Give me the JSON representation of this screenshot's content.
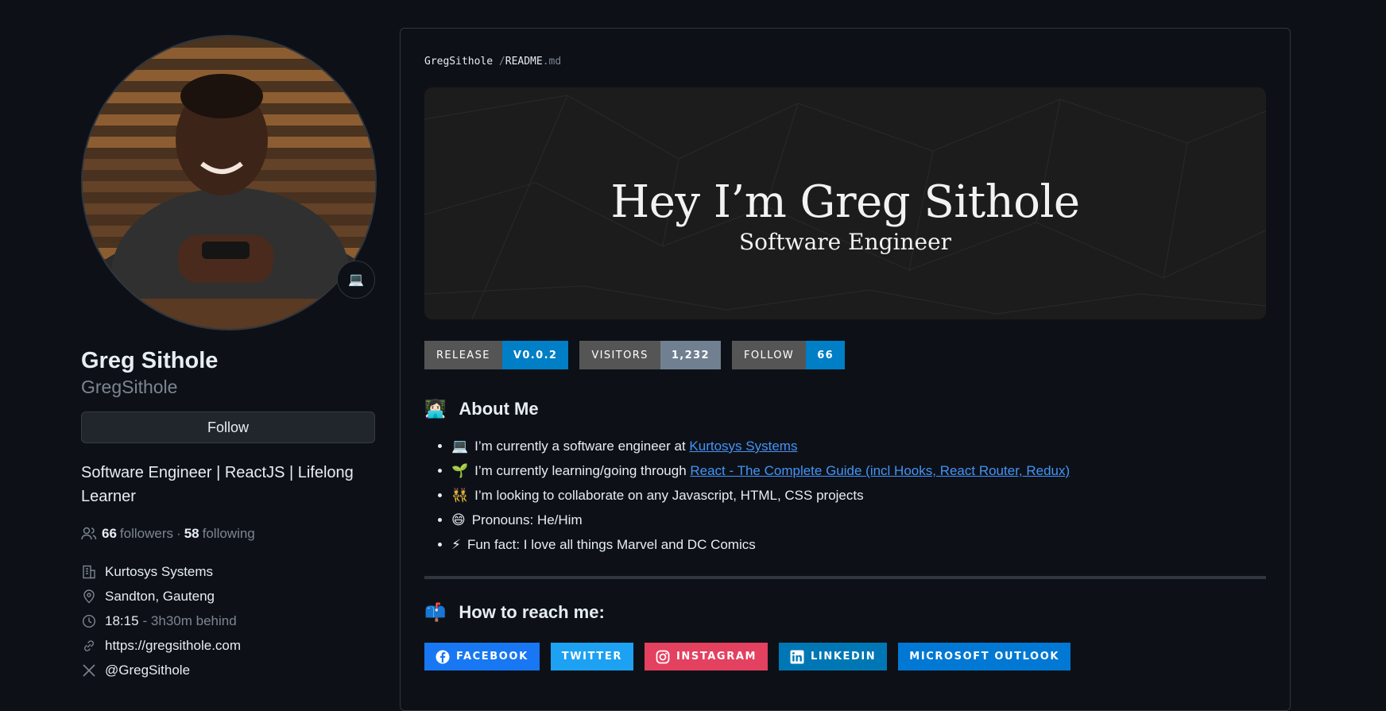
{
  "profile": {
    "name": "Greg Sithole",
    "login": "GregSithole",
    "status_emoji": "💻",
    "follow_label": "Follow",
    "bio": "Software Engineer | ReactJS | Lifelong Learner",
    "followers_count": "66",
    "followers_label": "followers",
    "separator": "·",
    "following_count": "58",
    "following_label": "following",
    "company": "Kurtosys Systems",
    "location": "Sandton, Gauteng",
    "local_time": "18:15",
    "time_offset": "- 3h30m behind",
    "website": "https://gregsithole.com",
    "twitter": "@GregSithole"
  },
  "readme": {
    "path_user": "GregSithole",
    "path_sep": "/",
    "path_file": "README",
    "path_ext": ".md",
    "banner_title": "Hey I’m Greg Sithole",
    "banner_subtitle": "Software Engineer",
    "badges": [
      {
        "label": "RELEASE",
        "value": "V0.0.2",
        "color": "#007ec6"
      },
      {
        "label": "VISITORS",
        "value": "1,232",
        "color": "#708090"
      },
      {
        "label": "FOLLOW",
        "value": "66",
        "color": "#007ec6"
      }
    ],
    "about_heading_emoji": "👩🏻‍💻",
    "about_heading": "About Me",
    "about_items": [
      {
        "emoji": "💻",
        "text": "I’m currently a software engineer at ",
        "link": "Kurtosys Systems"
      },
      {
        "emoji": "🌱",
        "text": "I’m currently learning/going through ",
        "link": "React - The Complete Guide (incl Hooks, React Router, Redux)"
      },
      {
        "emoji": "👯",
        "text": "I’m looking to collaborate on any Javascript, HTML, CSS projects",
        "link": ""
      },
      {
        "emoji": "😄",
        "text": "Pronouns: He/Him",
        "link": ""
      },
      {
        "emoji": "⚡",
        "text": "Fun fact: I love all things Marvel and DC Comics",
        "link": ""
      }
    ],
    "reach_heading_emoji": "📫",
    "reach_heading": "How to reach me:",
    "socials": [
      {
        "label": "FACEBOOK",
        "color": "#1877f2",
        "icon": "facebook-icon"
      },
      {
        "label": "TWITTER",
        "color": "#1da1f2",
        "icon": ""
      },
      {
        "label": "INSTAGRAM",
        "color": "#e4405f",
        "icon": "instagram-icon"
      },
      {
        "label": "LINKEDIN",
        "color": "#0077b5",
        "icon": "linkedin-icon"
      },
      {
        "label": "MICROSOFT OUTLOOK",
        "color": "#0078d4",
        "icon": ""
      }
    ]
  },
  "colors": {
    "background": "#0d1117",
    "text": "#e6edf3",
    "muted": "#7d8590",
    "link": "#4493f8",
    "border": "#30363d"
  }
}
